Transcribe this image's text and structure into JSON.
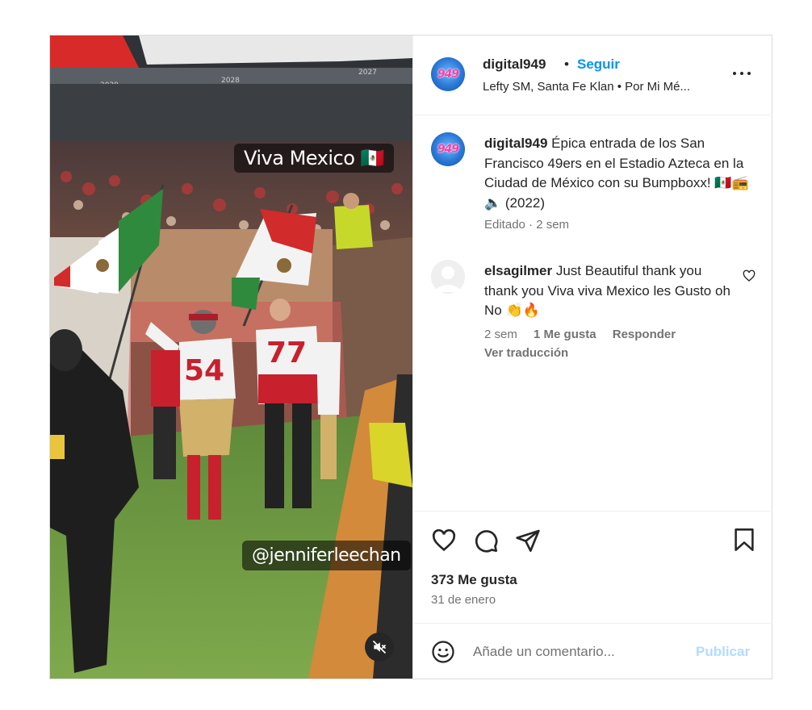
{
  "post": {
    "media": {
      "overlay_title": "Viva Mexico 🇲🇽",
      "overlay_handle": "@jenniferleechan",
      "jersey_left": "54",
      "jersey_right": "77",
      "stadium_marks": [
        "2029",
        "2028",
        "2027"
      ],
      "mute_icon": "speaker-muted-icon"
    },
    "header": {
      "avatar_text": "949",
      "username": "digital949",
      "separator": "•",
      "follow_label": "Seguir",
      "music": "Lefty SM, Santa Fe Klan • Por Mi Mé...",
      "more_icon": "more-horizontal-icon"
    },
    "caption": {
      "avatar_text": "949",
      "username": "digital949",
      "text": "Épica entrada de los San Francisco 49ers en el Estadio Azteca en la Ciudad de México con su Bumpboxx! 🇲🇽📻🔈 (2022)",
      "meta": "Editado · 2 sem"
    },
    "comments": [
      {
        "username": "elsagilmer",
        "text": "Just Beautiful thank you thank you Viva viva Mexico les Gusto oh No 👏🔥",
        "time": "2 sem",
        "likes": "1 Me gusta",
        "reply_label": "Responder",
        "translate_label": "Ver traducción"
      }
    ],
    "actions": {
      "like_icon": "heart-icon",
      "comment_icon": "comment-icon",
      "share_icon": "share-icon",
      "save_icon": "bookmark-icon",
      "likes_count": "373 Me gusta",
      "date": "31 de enero"
    },
    "add_comment": {
      "placeholder": "Añade un comentario...",
      "publish_label": "Publicar"
    },
    "colors": {
      "accent": "#0095f6",
      "publish_disabled": "#b3dbff",
      "muted_text": "#737373",
      "border": "#dbdbdb"
    }
  }
}
